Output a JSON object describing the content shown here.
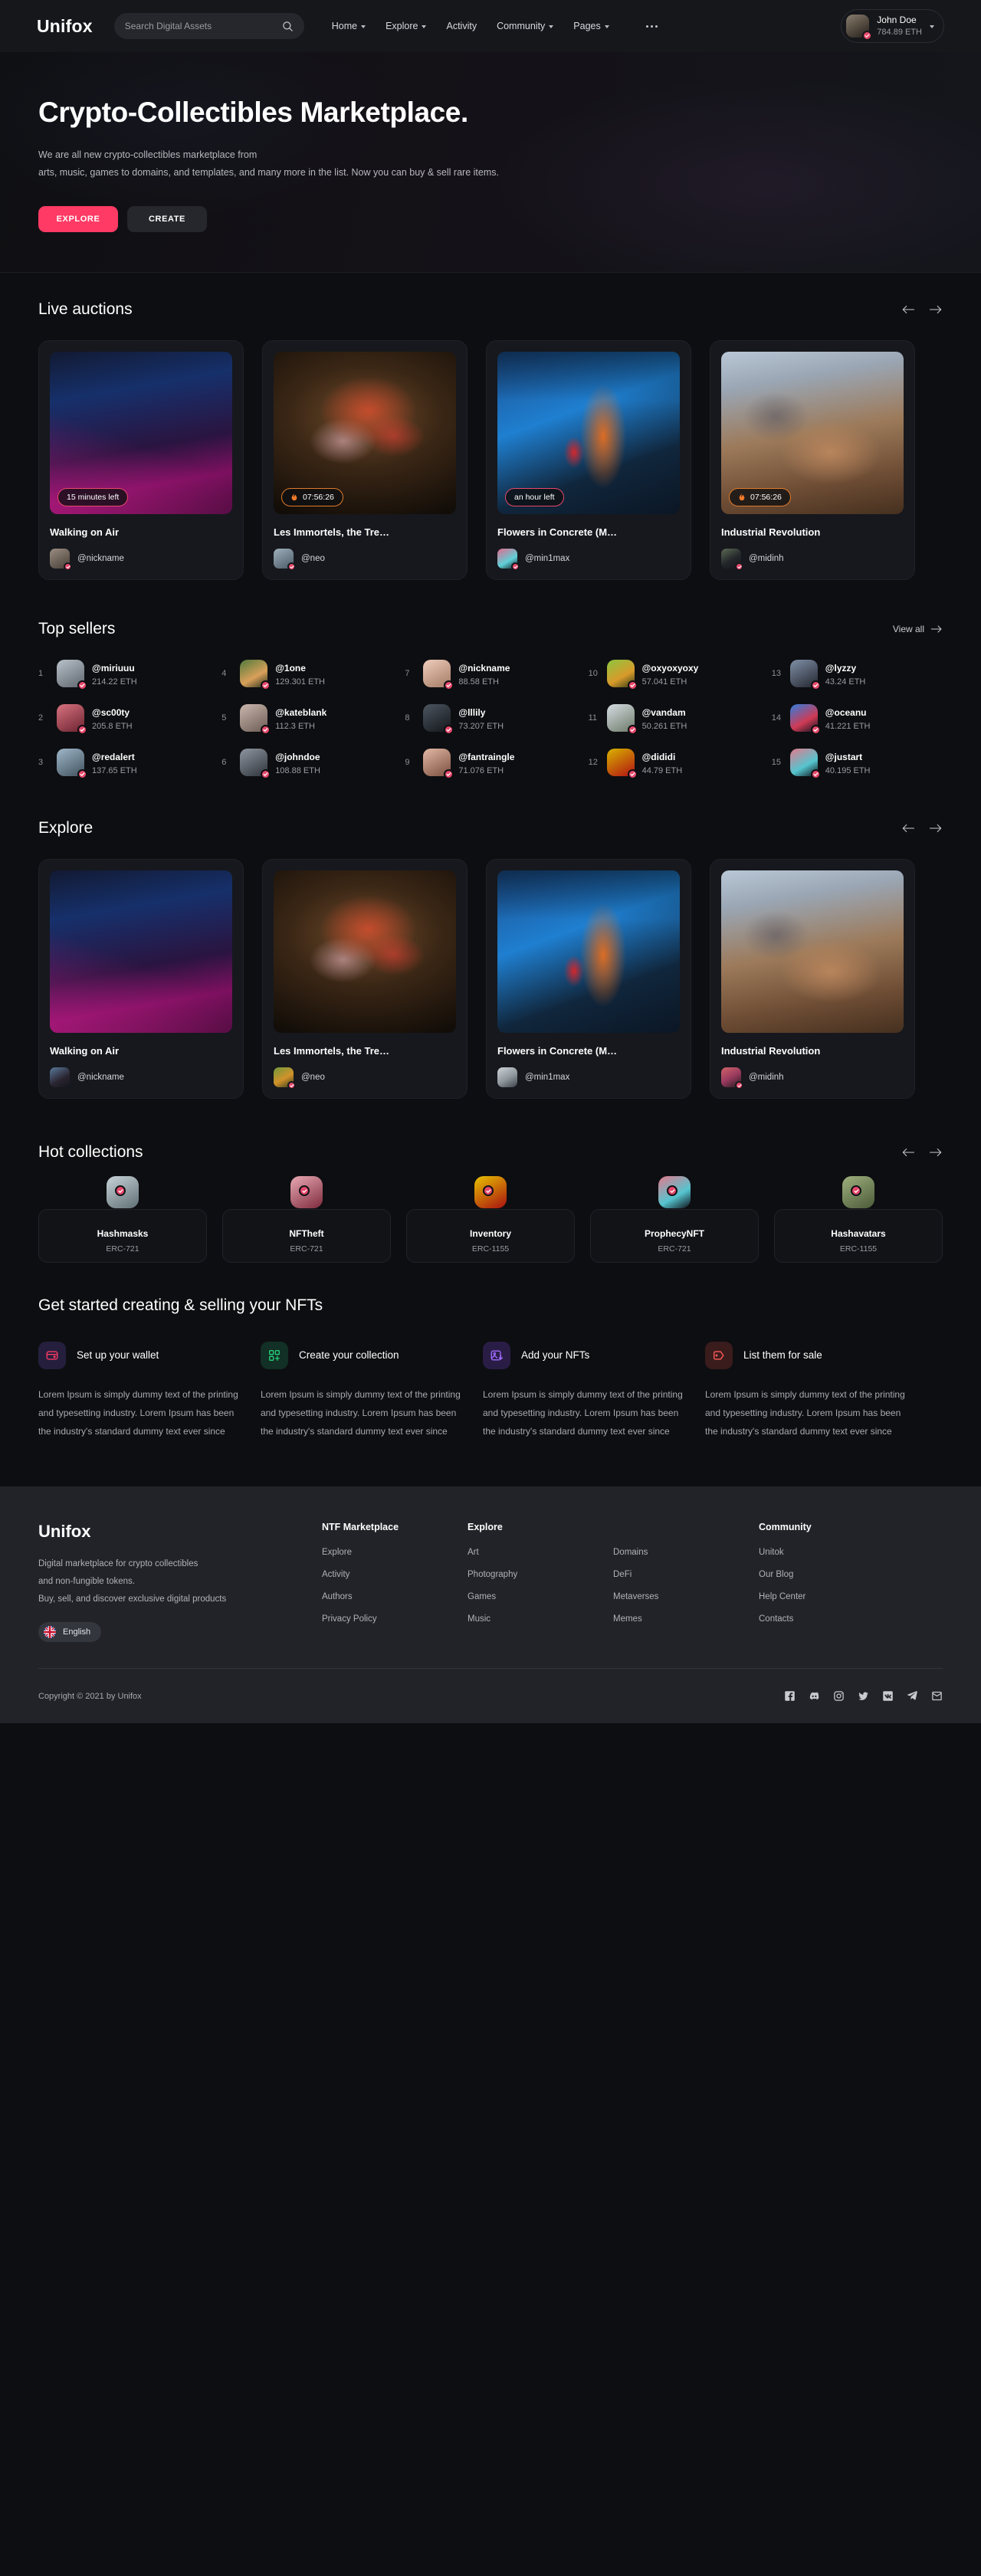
{
  "header": {
    "logo": "Unifox",
    "search": {
      "placeholder": "Search Digital Assets",
      "value": ""
    },
    "nav": [
      {
        "label": "Home",
        "caret": true
      },
      {
        "label": "Explore",
        "caret": true
      },
      {
        "label": "Activity",
        "caret": false
      },
      {
        "label": "Community",
        "caret": true
      },
      {
        "label": "Pages",
        "caret": true
      }
    ],
    "more_icon": "more-horizontal-icon",
    "profile": {
      "name": "John Doe",
      "balance": "784.89 ETH"
    }
  },
  "hero": {
    "title": "Crypto-Collectibles Marketplace.",
    "line1": "We are all new crypto-collectibles marketplace from",
    "line2": "arts, music, games to domains, and templates, and many more in the list. Now you can buy & sell rare items.",
    "explore_btn": "EXPLORE",
    "create_btn": "CREATE"
  },
  "live_auctions": {
    "title": "Live auctions",
    "cards": [
      {
        "title": "Walking on Air",
        "owner": "@nickname",
        "badge": "15 minutes left",
        "badge_style": "pink",
        "fire": false,
        "img": "art-pink-blue-concrete"
      },
      {
        "title": "Les Immortels, the Tre…",
        "owner": "@neo",
        "badge": "07:56:26",
        "badge_style": "orange",
        "fire": true,
        "img": "art-flowers-vase"
      },
      {
        "title": "Flowers in Concrete (M…",
        "owner": "@min1max",
        "badge": "an hour left",
        "badge_style": "pink",
        "fire": false,
        "img": "art-blue-orange-paint"
      },
      {
        "title": "Industrial Revolution",
        "owner": "@midinh",
        "badge": "07:56:26",
        "badge_style": "orange",
        "fire": true,
        "img": "art-baroque-sky"
      }
    ]
  },
  "top_sellers": {
    "title": "Top sellers",
    "view_all": "View all",
    "sellers": [
      {
        "rank": "1",
        "name": "@miriuuu",
        "eth": "214.22 ETH"
      },
      {
        "rank": "2",
        "name": "@sc00ty",
        "eth": "205.8 ETH"
      },
      {
        "rank": "3",
        "name": "@redalert",
        "eth": "137.65 ETH"
      },
      {
        "rank": "4",
        "name": "@1one",
        "eth": "129.301 ETH"
      },
      {
        "rank": "5",
        "name": "@kateblank",
        "eth": "112.3 ETH"
      },
      {
        "rank": "6",
        "name": "@johndoe",
        "eth": "108.88 ETH"
      },
      {
        "rank": "7",
        "name": "@nickname",
        "eth": "88.58 ETH"
      },
      {
        "rank": "8",
        "name": "@lllily",
        "eth": "73.207 ETH"
      },
      {
        "rank": "9",
        "name": "@fantraingle",
        "eth": "71.076 ETH"
      },
      {
        "rank": "10",
        "name": "@oxyoxyoxy",
        "eth": "57.041 ETH"
      },
      {
        "rank": "11",
        "name": "@vandam",
        "eth": "50.261 ETH"
      },
      {
        "rank": "12",
        "name": "@dididi",
        "eth": "44.79 ETH"
      },
      {
        "rank": "13",
        "name": "@lyzzy",
        "eth": "43.24 ETH"
      },
      {
        "rank": "14",
        "name": "@oceanu",
        "eth": "41.221 ETH"
      },
      {
        "rank": "15",
        "name": "@justart",
        "eth": "40.195 ETH"
      }
    ]
  },
  "explore": {
    "title": "Explore",
    "cards": [
      {
        "title": "Walking on Air",
        "owner": "@nickname",
        "img": "art-pink-blue-concrete"
      },
      {
        "title": "Les Immortels, the Tre…",
        "owner": "@neo",
        "img": "art-flowers-vase"
      },
      {
        "title": "Flowers in Concrete (M…",
        "owner": "@min1max",
        "img": "art-blue-orange-paint"
      },
      {
        "title": "Industrial Revolution",
        "owner": "@midinh",
        "img": "art-baroque-sky"
      }
    ]
  },
  "hot_collections": {
    "title": "Hot collections",
    "items": [
      {
        "name": "Hashmasks",
        "standard": "ERC-721"
      },
      {
        "name": "NFTheft",
        "standard": "ERC-721"
      },
      {
        "name": "Inventory",
        "standard": "ERC-1155"
      },
      {
        "name": "ProphecyNFT",
        "standard": "ERC-721"
      },
      {
        "name": "Hashavatars",
        "standard": "ERC-1155"
      }
    ]
  },
  "get_started": {
    "title": "Get started creating & selling your NFTs",
    "body": "Lorem Ipsum is simply dummy text of the printing and typesetting industry. Lorem Ipsum has been the industry's standard dummy text ever since",
    "steps": [
      {
        "title": "Set up your wallet",
        "icon": "wallet-icon",
        "icon_bg": "#251f3d",
        "icon_color": "#ff3a64"
      },
      {
        "title": "Create your collection",
        "icon": "grid-plus-icon",
        "icon_bg": "#123025",
        "icon_color": "#25d07a"
      },
      {
        "title": "Add your NFTs",
        "icon": "image-add-icon",
        "icon_bg": "#2a1d45",
        "icon_color": "#a06bff"
      },
      {
        "title": "List them for sale",
        "icon": "price-tag-icon",
        "icon_bg": "#3a1c1c",
        "icon_color": "#ff5a5a"
      }
    ]
  },
  "footer": {
    "logo": "Unifox",
    "desc_l1": "Digital marketplace for crypto collectibles",
    "desc_l2": "and non-fungible tokens.",
    "desc_l3": "Buy, sell, and discover exclusive digital products",
    "language": "English",
    "columns": [
      {
        "head": "NTF Marketplace",
        "links": [
          "Explore",
          "Activity",
          "Authors",
          "Privacy Policy"
        ]
      },
      {
        "head": "Explore",
        "links": [
          "Art",
          "Photography",
          "Games",
          "Music"
        ]
      },
      {
        "head": "",
        "links": [
          "Domains",
          "DeFi",
          "Metaverses",
          "Memes"
        ]
      },
      {
        "head": "Community",
        "links": [
          "Unitok",
          "Our Blog",
          "Help Center",
          "Contacts"
        ]
      }
    ],
    "copyright": "Copyright © 2021 by Unifox",
    "socials": [
      "facebook-icon",
      "discord-icon",
      "instagram-icon",
      "twitter-icon",
      "vk-icon",
      "telegram-icon",
      "mail-icon"
    ]
  },
  "colors": {
    "accent": "#ff3a64",
    "bg": "#0d0e11",
    "card": "#16181d",
    "footer": "#212329"
  }
}
